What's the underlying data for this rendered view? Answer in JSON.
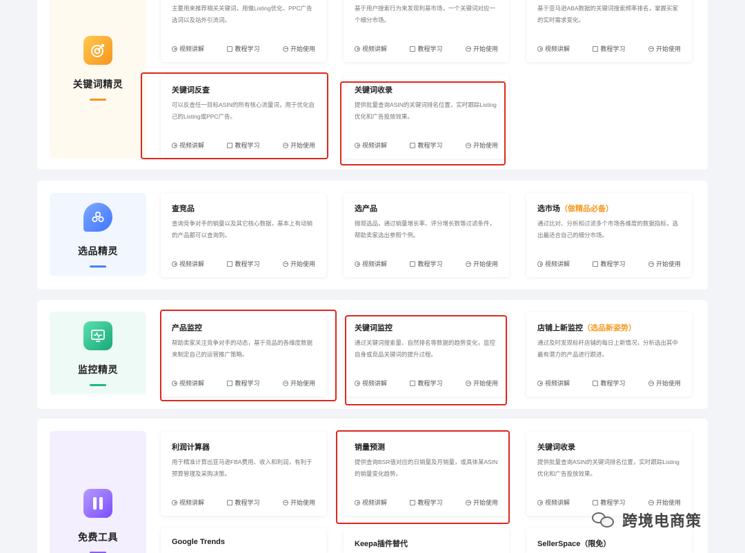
{
  "actions": {
    "video": "视频讲解",
    "tutorial": "教程学习",
    "start": "开始使用"
  },
  "categories": [
    {
      "label": "关键词精灵",
      "color": "#f7941d",
      "bg": "#fffaf0",
      "icon": "target-icon"
    },
    {
      "label": "选品精灵",
      "color": "#4a7dff",
      "bg": "#f1f6ff",
      "icon": "cluster-icon"
    },
    {
      "label": "监控精灵",
      "color": "#22b585",
      "bg": "#eefaf5",
      "icon": "monitor-icon"
    },
    {
      "label": "免费工具",
      "color": "#8b5cf6",
      "bg": "#f3efff",
      "icon": "tools-icon"
    }
  ],
  "cards": {
    "kw_top1": {
      "title": "",
      "desc": "主要用来推荐相关关键词，用做Listing优化、PPC广告选词以及站外引流词。"
    },
    "kw_top2": {
      "title": "",
      "desc": "基于用户搜索行为来发现利基市场，一个关键词对应一个细分市场。"
    },
    "kw_top3": {
      "title": "",
      "desc": "基于亚马逊ABA数据的关键词搜索频率排名，掌握买家的实时需求变化。"
    },
    "kw_reverse": {
      "title": "关键词反查",
      "desc": "可以反查任一目标ASIN的所有核心流量词，用于优化自己的Listing或PPC广告。"
    },
    "kw_index": {
      "title": "关键词收录",
      "desc": "提供批量查询ASIN的关键词排名位置，实时跟踪Listing优化和广告投放效果。"
    },
    "competitor": {
      "title": "查竞品",
      "desc": "查询竞争对手的销量以及其它核心数据，基本上有动销的产品都可以查询到。"
    },
    "product": {
      "title": "选产品",
      "desc": "微观选品，通过销量增长率、评分增长数等过滤条件，帮助卖家选出参照个例。"
    },
    "market": {
      "title": "选市场",
      "badge": "（做精品必备）",
      "desc": "通过比对、分析和过滤多个市场各维度的数据指标，选出最适合自己的细分市场。"
    },
    "prod_monitor": {
      "title": "产品监控",
      "desc": "帮助卖家关注竞争对手的动态，基于竞品的各维度数据来制定自己的运营推广策略。"
    },
    "kw_monitor": {
      "title": "关键词监控",
      "desc": "通过关键词搜索量、自然排名等数据的趋势变化，监控自身或竞品关键词的提升过程。"
    },
    "store_monitor": {
      "title": "店铺上新监控",
      "badge": "（选品新姿势）",
      "desc": "通过及时发现标杆店铺的每日上新情况，分析选出其中最有潜力的产品进行跟进。"
    },
    "profit": {
      "title": "利润计算器",
      "desc": "用于精准计算出亚马逊FBA费用、收入和利润，有利于预算管理及采购决策。"
    },
    "sales_est": {
      "title": "销量预测",
      "desc": "提供查询BSR值对应的日销量及月销量，或具体某ASIN的销量变化趋势。"
    },
    "kw_index2": {
      "title": "关键词收录",
      "desc": "提供批量查询ASIN的关键词排名位置，实时跟踪Listing优化和广告投放效果。"
    },
    "gtrends": {
      "title": "Google Trends",
      "desc": ""
    },
    "keepa": {
      "title": "Keepa插件替代",
      "desc": ""
    },
    "sellerspace": {
      "title": "SellerSpace",
      "badge": "（限免）",
      "desc": ""
    }
  },
  "watermark": {
    "text": "跨境电商策",
    "icon": "wechat-icon"
  }
}
